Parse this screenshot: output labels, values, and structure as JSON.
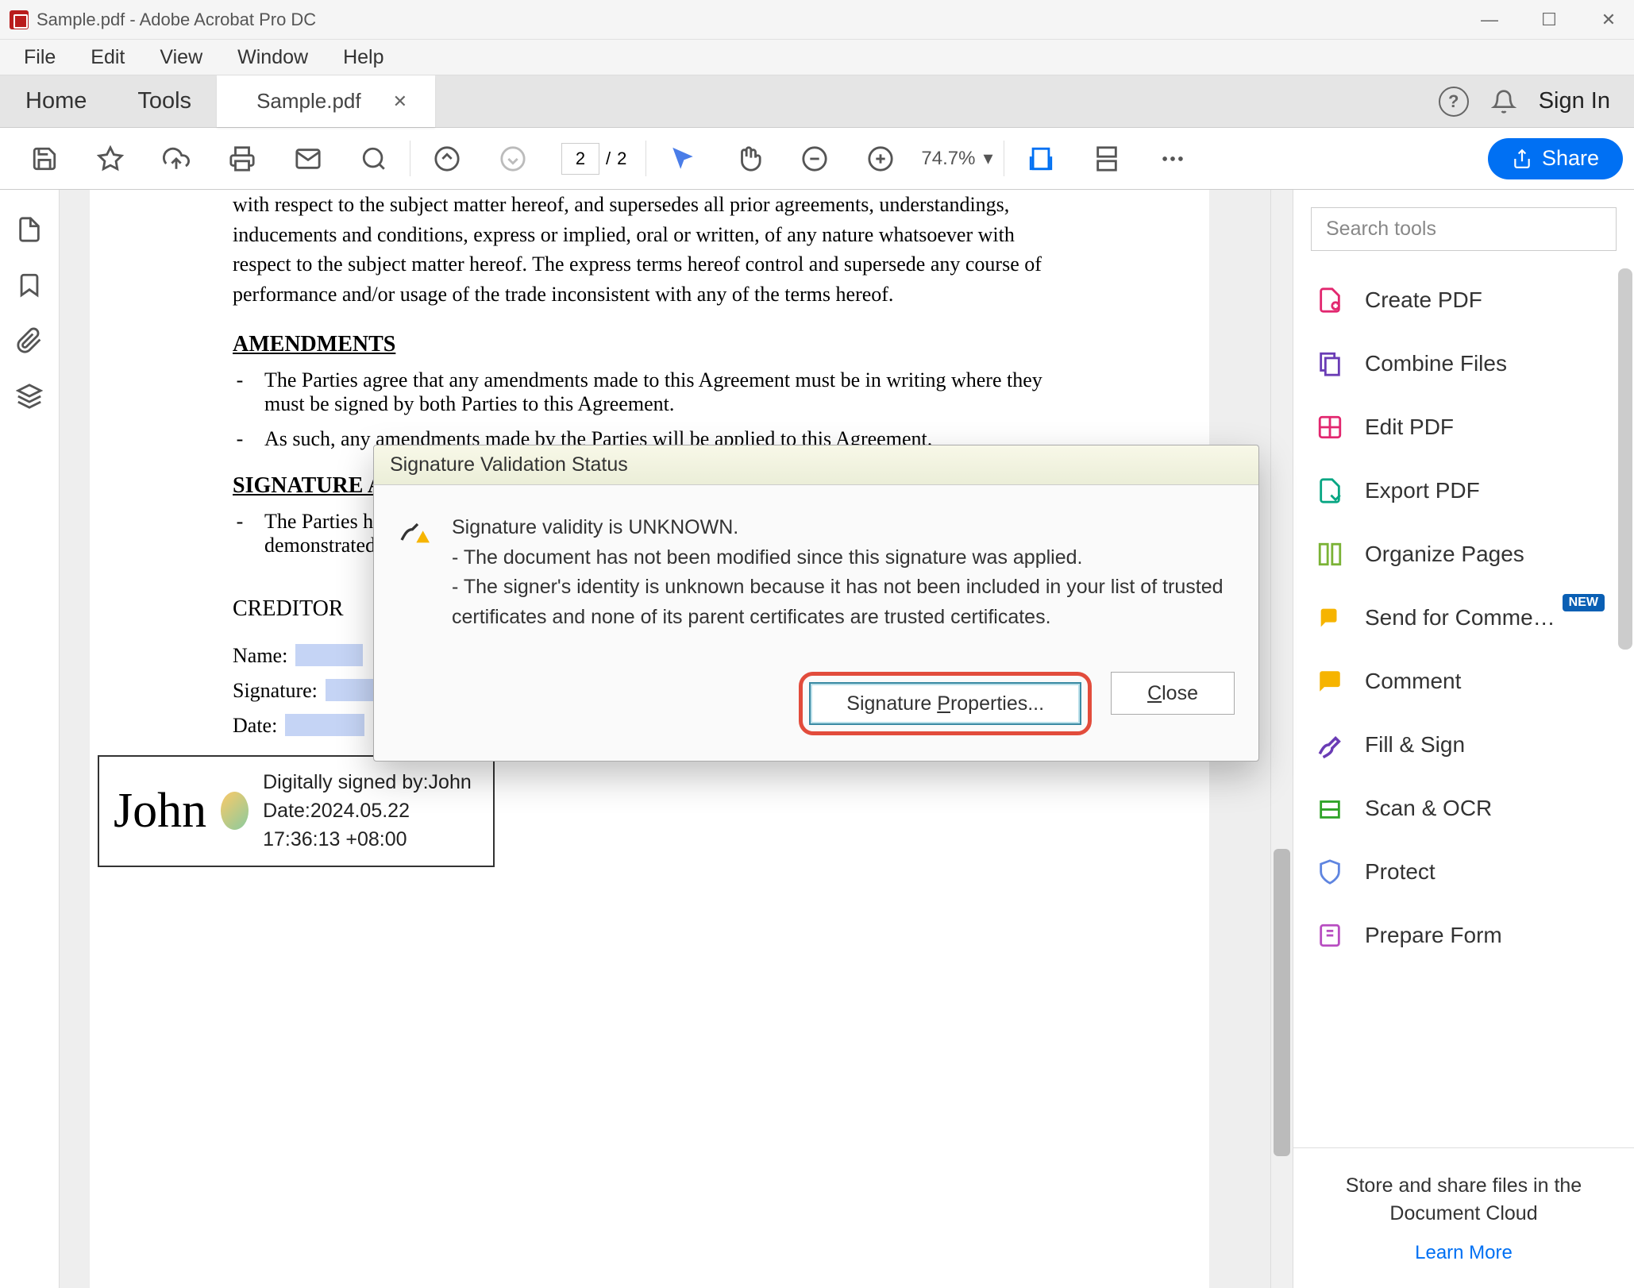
{
  "titlebar": {
    "title": "Sample.pdf - Adobe Acrobat Pro DC"
  },
  "menubar": [
    "File",
    "Edit",
    "View",
    "Window",
    "Help"
  ],
  "tabs": {
    "home": "Home",
    "tools": "Tools",
    "doc": "Sample.pdf"
  },
  "topRight": {
    "signin": "Sign In"
  },
  "toolbar": {
    "pageCurrent": "2",
    "pageSep": "/",
    "pageTotal": "2",
    "zoom": "74.7%",
    "share": "Share"
  },
  "document": {
    "intro": "with respect to the subject matter hereof, and supersedes all prior agreements, understandings, inducements and conditions, express or implied, oral or written, of any nature whatsoever with respect to the subject matter hereof. The express terms hereof control and supersede any course of performance and/or usage of the trade inconsistent with any of the terms hereof.",
    "h1": "AMENDMENTS",
    "a1": "The Parties agree that any amendments made to this Agreement must be in writing where they must be signed by both Parties to this Agreement.",
    "a2": "As such, any amendments made by the Parties will be applied to this Agreement.",
    "h2": "SIGNATURE A",
    "s1": "The Parties h",
    "s1b": "demonstrated",
    "creditor": "CREDITOR",
    "name": "Name:",
    "signature": "Signature:",
    "date": "Date:",
    "sigName": "John",
    "sigMeta1": "Digitally signed by:John",
    "sigMeta2": "Date:2024.05.22 17:36:13 +08:00"
  },
  "rightPanel": {
    "searchPlaceholder": "Search tools",
    "tools": [
      "Create PDF",
      "Combine Files",
      "Edit PDF",
      "Export PDF",
      "Organize Pages",
      "Send for Comme…",
      "Comment",
      "Fill & Sign",
      "Scan & OCR",
      "Protect",
      "Prepare Form"
    ],
    "newBadge": "NEW",
    "footer": "Store and share files in the Document Cloud",
    "learnMore": "Learn More"
  },
  "dialog": {
    "title": "Signature Validation Status",
    "line1": "Signature validity is UNKNOWN.",
    "line2": "- The document has not been modified since this signature was applied.",
    "line3": "- The signer's identity is unknown because it has not been included in your list of trusted certificates and none of its parent certificates are trusted certificates.",
    "btnProps": "Signature Properties...",
    "btnClose": "Close"
  }
}
